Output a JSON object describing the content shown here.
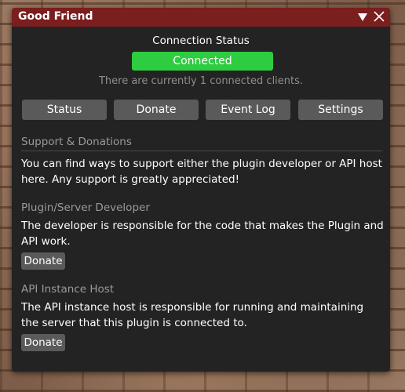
{
  "window": {
    "title": "Good Friend",
    "collapse_icon": "triangle-down-icon",
    "close_icon": "close-icon"
  },
  "connection": {
    "label": "Connection Status",
    "status": "Connected",
    "status_color": "#2ecc40",
    "info": "There are currently 1 connected clients."
  },
  "tabs": [
    {
      "label": "Status"
    },
    {
      "label": "Donate"
    },
    {
      "label": "Event Log"
    },
    {
      "label": "Settings"
    }
  ],
  "donate_page": {
    "heading": "Support & Donations",
    "intro": "You can find ways to support either the plugin developer or API host here. Any support is greatly appreciated!",
    "sections": [
      {
        "heading": "Plugin/Server Developer",
        "text": "The developer is responsible for the code that makes the Plugin and API work.",
        "button": "Donate"
      },
      {
        "heading": "API Instance Host",
        "text": "The API instance host is responsible for running and maintaining the server that this plugin is connected to.",
        "button": "Donate"
      }
    ]
  },
  "colors": {
    "titlebar": "#7a1e1e",
    "panel": "#232323",
    "button": "#5a5a5a",
    "muted_text": "#9a9a9a"
  }
}
